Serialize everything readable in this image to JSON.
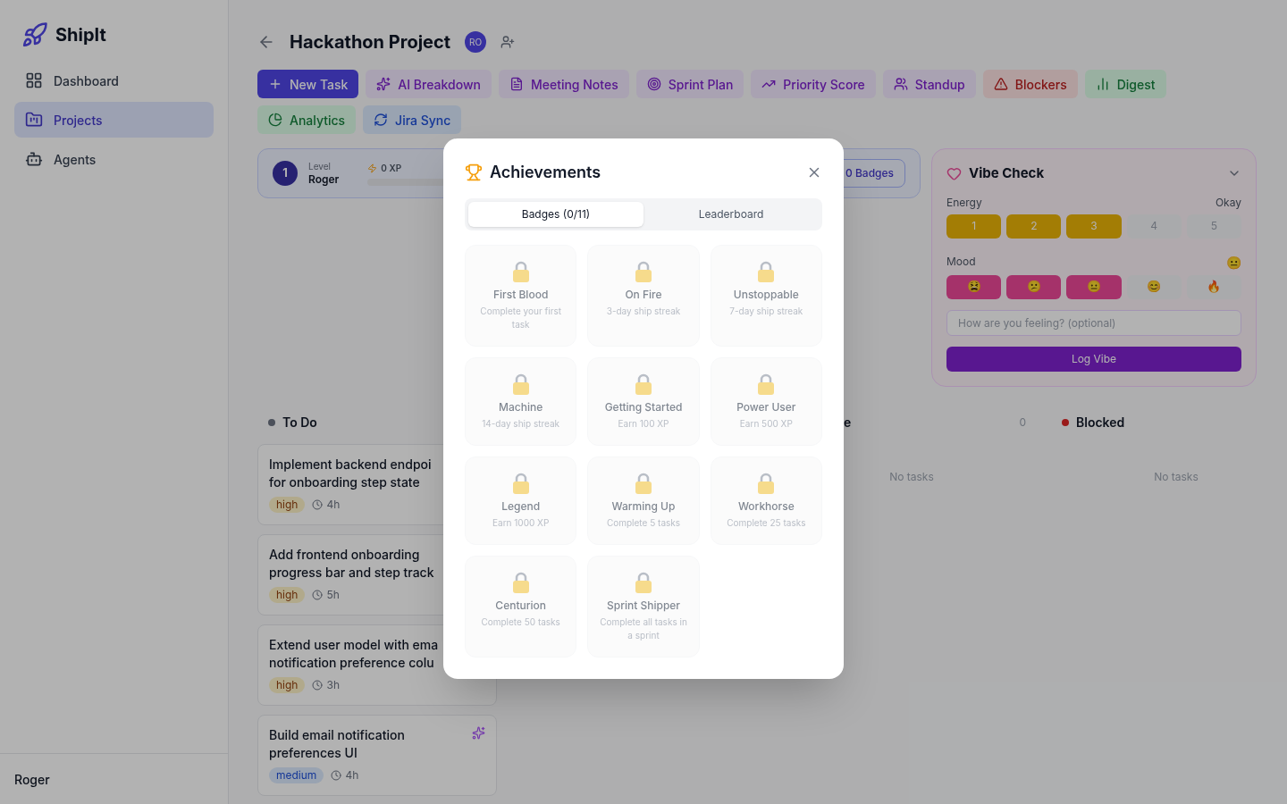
{
  "sidebar": {
    "logo": "ShipIt",
    "items": [
      {
        "label": "Dashboard",
        "selected": false
      },
      {
        "label": "Projects",
        "selected": true
      },
      {
        "label": "Agents",
        "selected": false
      }
    ],
    "user": "Roger"
  },
  "header": {
    "title": "Hackathon Project",
    "avatar": "RO"
  },
  "toolbar": [
    {
      "label": "New Task",
      "kind": "primary"
    },
    {
      "label": "AI Breakdown",
      "kind": "tool"
    },
    {
      "label": "Meeting Notes",
      "kind": "tool"
    },
    {
      "label": "Sprint Plan",
      "kind": "tool"
    },
    {
      "label": "Priority Score",
      "kind": "tool"
    },
    {
      "label": "Standup",
      "kind": "tool"
    },
    {
      "label": "Blockers",
      "kind": "alert"
    },
    {
      "label": "Digest",
      "kind": "report"
    },
    {
      "label": "Analytics",
      "kind": "report"
    },
    {
      "label": "Jira Sync",
      "kind": "integration"
    }
  ],
  "level_card": {
    "level": "1",
    "level_label": "Level",
    "name": "Roger",
    "xp": "0 XP",
    "badges_button": "0 Badges"
  },
  "vibe_check": {
    "title": "Vibe Check",
    "energy_label": "Energy",
    "energy_reading": "Okay",
    "energy": [
      {
        "label": "1",
        "selected": true
      },
      {
        "label": "2",
        "selected": true
      },
      {
        "label": "3",
        "selected": true
      },
      {
        "label": "4",
        "selected": false
      },
      {
        "label": "5",
        "selected": false
      }
    ],
    "mood_label": "Mood",
    "mood_reading": "😐",
    "mood": [
      {
        "label": "😫",
        "selected": true
      },
      {
        "label": "😕",
        "selected": true
      },
      {
        "label": "😐",
        "selected": true
      },
      {
        "label": "😊",
        "selected": false
      },
      {
        "label": "🔥",
        "selected": false
      }
    ],
    "placeholder": "How are you feeling? (optional)",
    "button": "Log Vibe"
  },
  "columns": [
    {
      "title": "To Do",
      "color": "#4b505a",
      "cards": [
        {
          "title_lines": [
            "Implement backend endpoi",
            "for onboarding step state"
          ],
          "priority": "high",
          "estimate": "4h",
          "ai": false
        },
        {
          "title_lines": [
            "Add frontend onboarding",
            "progress bar and step track"
          ],
          "priority": "high",
          "estimate": "5h",
          "ai": false
        },
        {
          "title_lines": [
            "Extend user model with ema",
            "notification preference colu"
          ],
          "priority": "high",
          "estimate": "3h",
          "ai": false
        },
        {
          "title_lines": [
            "Build email notification",
            "preferences UI"
          ],
          "priority": "medium",
          "estimate": "4h",
          "ai": true
        }
      ]
    },
    {
      "title": "e",
      "count": "0",
      "empty": "No tasks"
    },
    {
      "title": "Blocked",
      "color": "#9a1a1a",
      "empty": "No tasks"
    }
  ],
  "modal": {
    "title": "Achievements",
    "tabs": [
      {
        "label": "Badges (0/11)",
        "selected": true
      },
      {
        "label": "Leaderboard",
        "selected": false
      }
    ],
    "badges": [
      {
        "name": "First Blood",
        "description": "Complete your first task",
        "locked": true
      },
      {
        "name": "On Fire",
        "description": "3-day ship streak",
        "locked": true
      },
      {
        "name": "Unstoppable",
        "description": "7-day ship streak",
        "locked": true
      },
      {
        "name": "Machine",
        "description": "14-day ship streak",
        "locked": true
      },
      {
        "name": "Getting Started",
        "description": "Earn 100 XP",
        "locked": true
      },
      {
        "name": "Power User",
        "description": "Earn 500 XP",
        "locked": true
      },
      {
        "name": "Legend",
        "description": "Earn 1000 XP",
        "locked": true
      },
      {
        "name": "Warming Up",
        "description": "Complete 5 tasks",
        "locked": true
      },
      {
        "name": "Workhorse",
        "description": "Complete 25 tasks",
        "locked": true
      },
      {
        "name": "Centurion",
        "description": "Complete 50 tasks",
        "locked": true
      },
      {
        "name": "Sprint Shipper",
        "description": "Complete all tasks in a sprint",
        "locked": true
      }
    ]
  }
}
